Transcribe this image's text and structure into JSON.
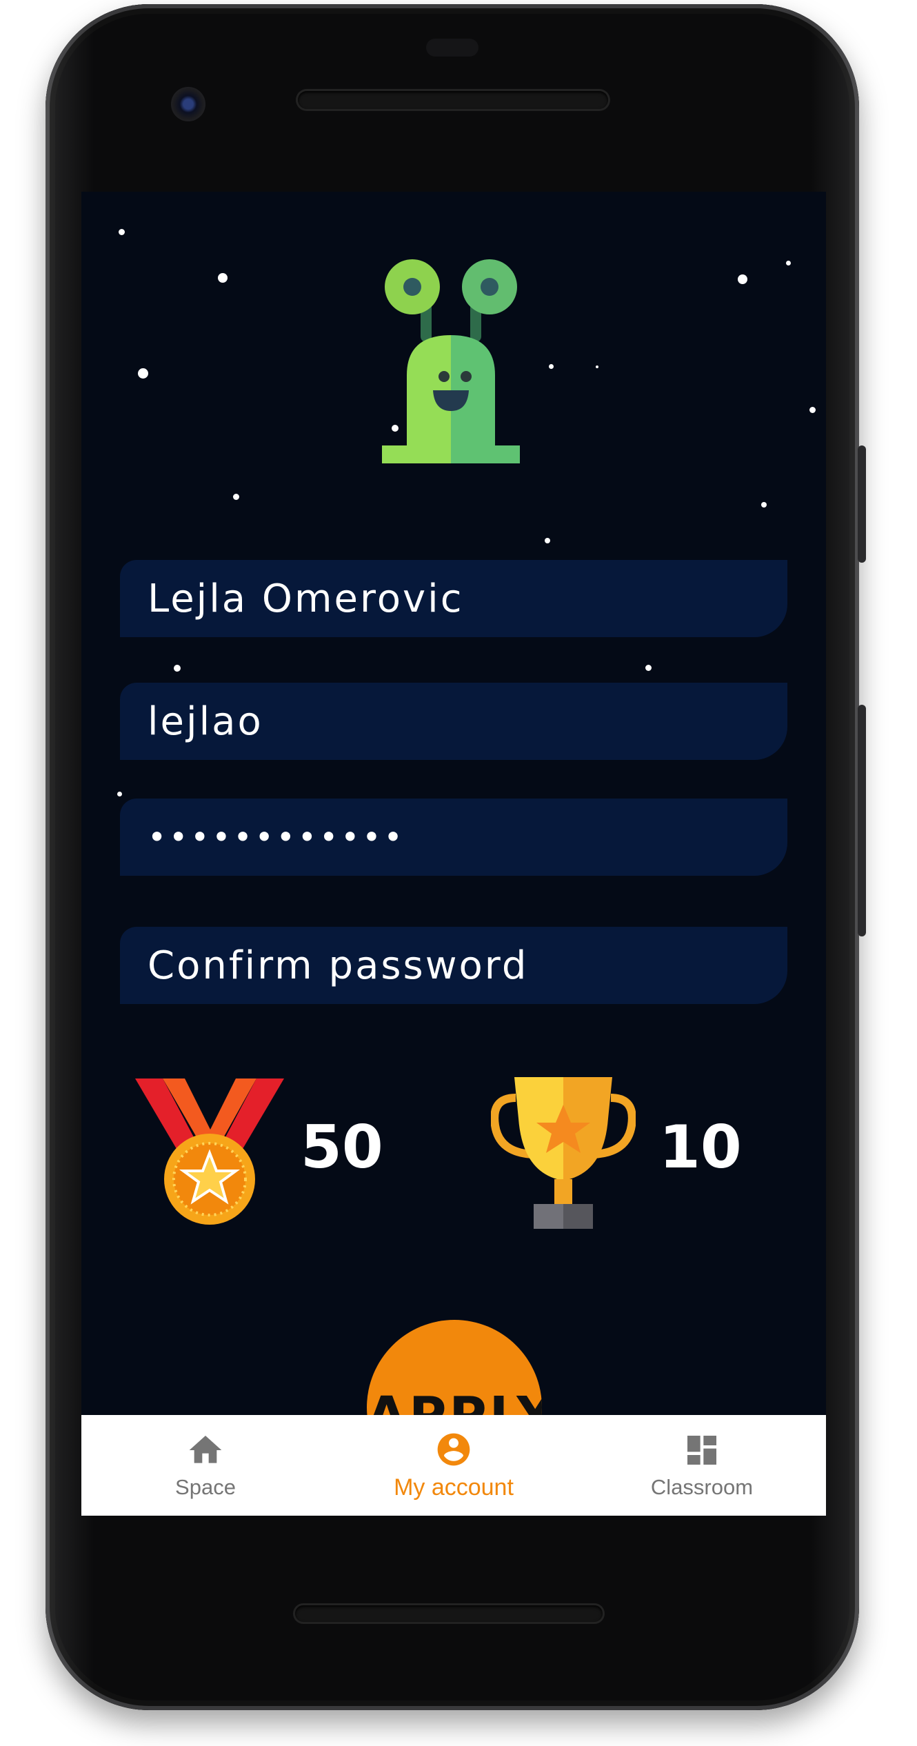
{
  "profile": {
    "name": "Lejla Omerovic",
    "username": "lejlao",
    "password": "••••••••••••",
    "confirm_placeholder": "Confirm password"
  },
  "stats": {
    "medals": "50",
    "trophies": "10"
  },
  "apply_button": {
    "label": "APPLY"
  },
  "nav": {
    "items": [
      {
        "label": "Space",
        "icon": "home-icon"
      },
      {
        "label": "My account",
        "icon": "account-circle-icon",
        "active": true
      },
      {
        "label": "Classroom",
        "icon": "dashboard-icon"
      }
    ]
  },
  "colors": {
    "background": "#040a16",
    "field": "#06183a",
    "accent": "#f2880c",
    "nav_inactive": "#757575"
  }
}
